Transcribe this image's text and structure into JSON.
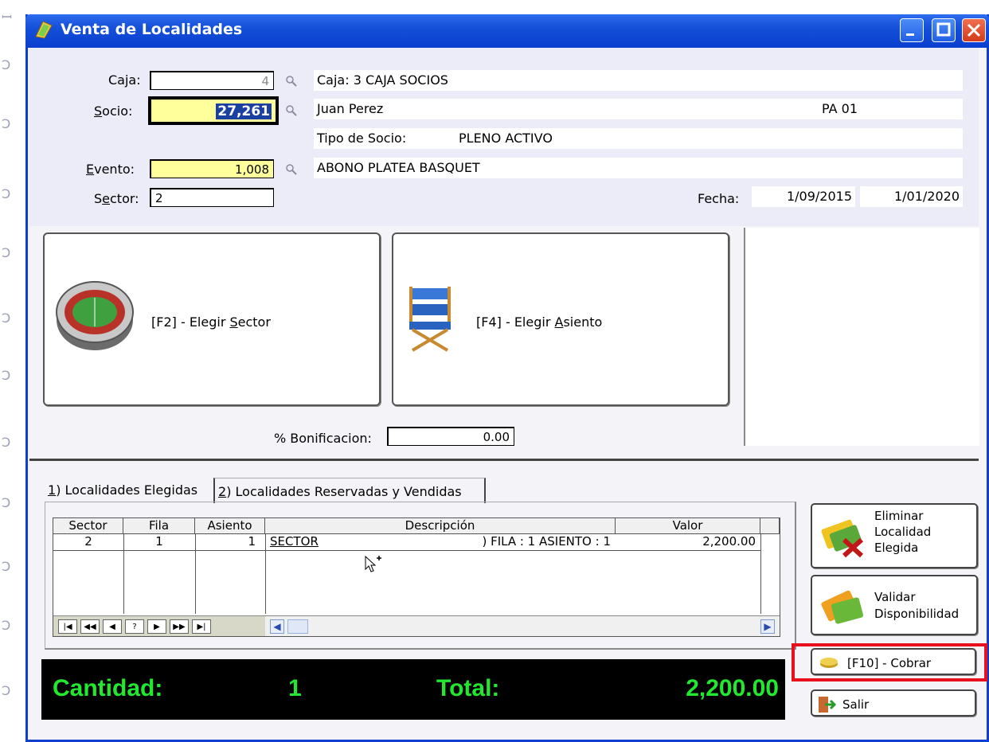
{
  "window": {
    "title": "Venta de Localidades"
  },
  "header": {
    "caja_label": "Caja:",
    "caja_value": "4",
    "caja_desc": "Caja: 3 CAJA SOCIOS",
    "socio_label": "Socio:",
    "socio_value": "27,261",
    "socio_name": "Juan Perez",
    "socio_code": "PA 01",
    "tipo_label": "Tipo de Socio:",
    "tipo_value": "PLENO ACTIVO",
    "evento_label": "Evento:",
    "evento_value": "1,008",
    "evento_desc": "ABONO PLATEA BASQUET",
    "sector_label": "Sector:",
    "sector_value": "2",
    "fecha_label": "Fecha:",
    "fecha_desde": "1/09/2015",
    "fecha_hasta": "1/01/2020"
  },
  "actions": {
    "elegir_sector": "[F2] - Elegir Sector",
    "elegir_asiento": "[F4] - Elegir Asiento",
    "bonificacion_label": "% Bonificacion:",
    "bonificacion_value": "0.00"
  },
  "tabs": [
    {
      "label": "1) Localidades Elegidas"
    },
    {
      "label": "2) Localidades Reservadas y Vendidas"
    }
  ],
  "grid": {
    "columns": [
      "Sector",
      "Fila",
      "Asiento",
      "Descripción",
      "Valor"
    ],
    "rows": [
      {
        "sector": "2",
        "fila": "1",
        "asiento": "1",
        "descripcion_left": "SECTOR",
        "descripcion_right": ") FILA : 1 ASIENTO : 1",
        "valor": "2,200.00"
      }
    ],
    "nav_buttons": [
      "|◀",
      "◀◀",
      "◀",
      "?",
      "▶",
      "▶▶",
      "▶|"
    ]
  },
  "side_buttons": {
    "eliminar": "Eliminar Localidad Elegida",
    "validar": "Validar Disponibilidad",
    "cobrar": "[F10] - Cobrar",
    "salir": "Salir"
  },
  "status": {
    "cantidad_label": "Cantidad:",
    "cantidad_value": "1",
    "total_label": "Total:",
    "total_value": "2,200.00"
  },
  "colors": {
    "titlebar": "#1450d8",
    "status_text": "#22e830",
    "highlight_box": "#e8101c",
    "yellow_field": "#ffff9c"
  }
}
